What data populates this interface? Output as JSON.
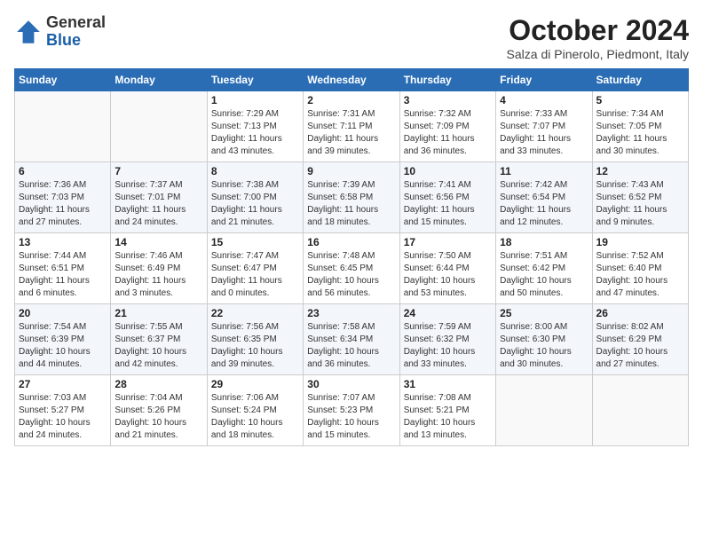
{
  "header": {
    "logo_line1": "General",
    "logo_line2": "Blue",
    "month_title": "October 2024",
    "location": "Salza di Pinerolo, Piedmont, Italy"
  },
  "days_of_week": [
    "Sunday",
    "Monday",
    "Tuesday",
    "Wednesday",
    "Thursday",
    "Friday",
    "Saturday"
  ],
  "weeks": [
    [
      {
        "day": "",
        "info": ""
      },
      {
        "day": "",
        "info": ""
      },
      {
        "day": "1",
        "info": "Sunrise: 7:29 AM\nSunset: 7:13 PM\nDaylight: 11 hours\nand 43 minutes."
      },
      {
        "day": "2",
        "info": "Sunrise: 7:31 AM\nSunset: 7:11 PM\nDaylight: 11 hours\nand 39 minutes."
      },
      {
        "day": "3",
        "info": "Sunrise: 7:32 AM\nSunset: 7:09 PM\nDaylight: 11 hours\nand 36 minutes."
      },
      {
        "day": "4",
        "info": "Sunrise: 7:33 AM\nSunset: 7:07 PM\nDaylight: 11 hours\nand 33 minutes."
      },
      {
        "day": "5",
        "info": "Sunrise: 7:34 AM\nSunset: 7:05 PM\nDaylight: 11 hours\nand 30 minutes."
      }
    ],
    [
      {
        "day": "6",
        "info": "Sunrise: 7:36 AM\nSunset: 7:03 PM\nDaylight: 11 hours\nand 27 minutes."
      },
      {
        "day": "7",
        "info": "Sunrise: 7:37 AM\nSunset: 7:01 PM\nDaylight: 11 hours\nand 24 minutes."
      },
      {
        "day": "8",
        "info": "Sunrise: 7:38 AM\nSunset: 7:00 PM\nDaylight: 11 hours\nand 21 minutes."
      },
      {
        "day": "9",
        "info": "Sunrise: 7:39 AM\nSunset: 6:58 PM\nDaylight: 11 hours\nand 18 minutes."
      },
      {
        "day": "10",
        "info": "Sunrise: 7:41 AM\nSunset: 6:56 PM\nDaylight: 11 hours\nand 15 minutes."
      },
      {
        "day": "11",
        "info": "Sunrise: 7:42 AM\nSunset: 6:54 PM\nDaylight: 11 hours\nand 12 minutes."
      },
      {
        "day": "12",
        "info": "Sunrise: 7:43 AM\nSunset: 6:52 PM\nDaylight: 11 hours\nand 9 minutes."
      }
    ],
    [
      {
        "day": "13",
        "info": "Sunrise: 7:44 AM\nSunset: 6:51 PM\nDaylight: 11 hours\nand 6 minutes."
      },
      {
        "day": "14",
        "info": "Sunrise: 7:46 AM\nSunset: 6:49 PM\nDaylight: 11 hours\nand 3 minutes."
      },
      {
        "day": "15",
        "info": "Sunrise: 7:47 AM\nSunset: 6:47 PM\nDaylight: 11 hours\nand 0 minutes."
      },
      {
        "day": "16",
        "info": "Sunrise: 7:48 AM\nSunset: 6:45 PM\nDaylight: 10 hours\nand 56 minutes."
      },
      {
        "day": "17",
        "info": "Sunrise: 7:50 AM\nSunset: 6:44 PM\nDaylight: 10 hours\nand 53 minutes."
      },
      {
        "day": "18",
        "info": "Sunrise: 7:51 AM\nSunset: 6:42 PM\nDaylight: 10 hours\nand 50 minutes."
      },
      {
        "day": "19",
        "info": "Sunrise: 7:52 AM\nSunset: 6:40 PM\nDaylight: 10 hours\nand 47 minutes."
      }
    ],
    [
      {
        "day": "20",
        "info": "Sunrise: 7:54 AM\nSunset: 6:39 PM\nDaylight: 10 hours\nand 44 minutes."
      },
      {
        "day": "21",
        "info": "Sunrise: 7:55 AM\nSunset: 6:37 PM\nDaylight: 10 hours\nand 42 minutes."
      },
      {
        "day": "22",
        "info": "Sunrise: 7:56 AM\nSunset: 6:35 PM\nDaylight: 10 hours\nand 39 minutes."
      },
      {
        "day": "23",
        "info": "Sunrise: 7:58 AM\nSunset: 6:34 PM\nDaylight: 10 hours\nand 36 minutes."
      },
      {
        "day": "24",
        "info": "Sunrise: 7:59 AM\nSunset: 6:32 PM\nDaylight: 10 hours\nand 33 minutes."
      },
      {
        "day": "25",
        "info": "Sunrise: 8:00 AM\nSunset: 6:30 PM\nDaylight: 10 hours\nand 30 minutes."
      },
      {
        "day": "26",
        "info": "Sunrise: 8:02 AM\nSunset: 6:29 PM\nDaylight: 10 hours\nand 27 minutes."
      }
    ],
    [
      {
        "day": "27",
        "info": "Sunrise: 7:03 AM\nSunset: 5:27 PM\nDaylight: 10 hours\nand 24 minutes."
      },
      {
        "day": "28",
        "info": "Sunrise: 7:04 AM\nSunset: 5:26 PM\nDaylight: 10 hours\nand 21 minutes."
      },
      {
        "day": "29",
        "info": "Sunrise: 7:06 AM\nSunset: 5:24 PM\nDaylight: 10 hours\nand 18 minutes."
      },
      {
        "day": "30",
        "info": "Sunrise: 7:07 AM\nSunset: 5:23 PM\nDaylight: 10 hours\nand 15 minutes."
      },
      {
        "day": "31",
        "info": "Sunrise: 7:08 AM\nSunset: 5:21 PM\nDaylight: 10 hours\nand 13 minutes."
      },
      {
        "day": "",
        "info": ""
      },
      {
        "day": "",
        "info": ""
      }
    ]
  ]
}
